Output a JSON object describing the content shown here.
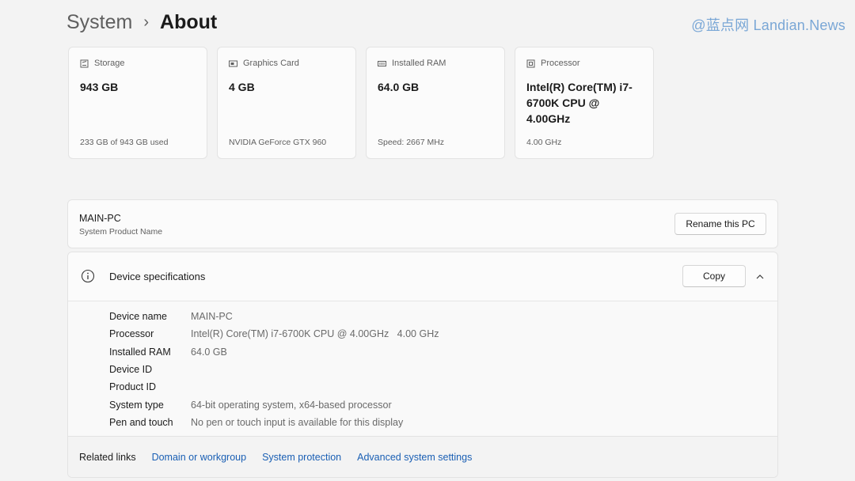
{
  "breadcrumb": {
    "parent": "System",
    "separator": "›",
    "current": "About"
  },
  "watermark": "@蓝点网 Landian.News",
  "cards": [
    {
      "icon": "storage-icon",
      "label": "Storage",
      "value": "943 GB",
      "sub": "233 GB of 943 GB used"
    },
    {
      "icon": "graphics-card-icon",
      "label": "Graphics Card",
      "value": "4 GB",
      "sub": "NVIDIA GeForce GTX 960"
    },
    {
      "icon": "ram-icon",
      "label": "Installed RAM",
      "value": "64.0 GB",
      "sub": "Speed: 2667 MHz"
    },
    {
      "icon": "processor-icon",
      "label": "Processor",
      "value": "Intel(R) Core(TM) i7-6700K CPU @ 4.00GHz",
      "sub": "4.00 GHz"
    }
  ],
  "pc": {
    "name": "MAIN-PC",
    "label": "System Product Name",
    "rename_label": "Rename this PC"
  },
  "specs": {
    "title": "Device specifications",
    "copy_label": "Copy",
    "rows": [
      {
        "key": "Device name",
        "value": "MAIN-PC"
      },
      {
        "key": "Processor",
        "value": "Intel(R) Core(TM) i7-6700K CPU @ 4.00GHz   4.00 GHz"
      },
      {
        "key": "Installed RAM",
        "value": "64.0 GB"
      },
      {
        "key": "Device ID",
        "value": ""
      },
      {
        "key": "Product ID",
        "value": ""
      },
      {
        "key": "System type",
        "value": "64-bit operating system, x64-based processor"
      },
      {
        "key": "Pen and touch",
        "value": "No pen or touch input is available for this display"
      }
    ]
  },
  "related": {
    "title": "Related links",
    "links": [
      "Domain or workgroup",
      "System protection",
      "Advanced system settings"
    ]
  },
  "colors": {
    "background": "#f3f3f3",
    "card": "#fbfbfb",
    "link": "#1a5fb4",
    "watermark": "#7aa7d6"
  }
}
